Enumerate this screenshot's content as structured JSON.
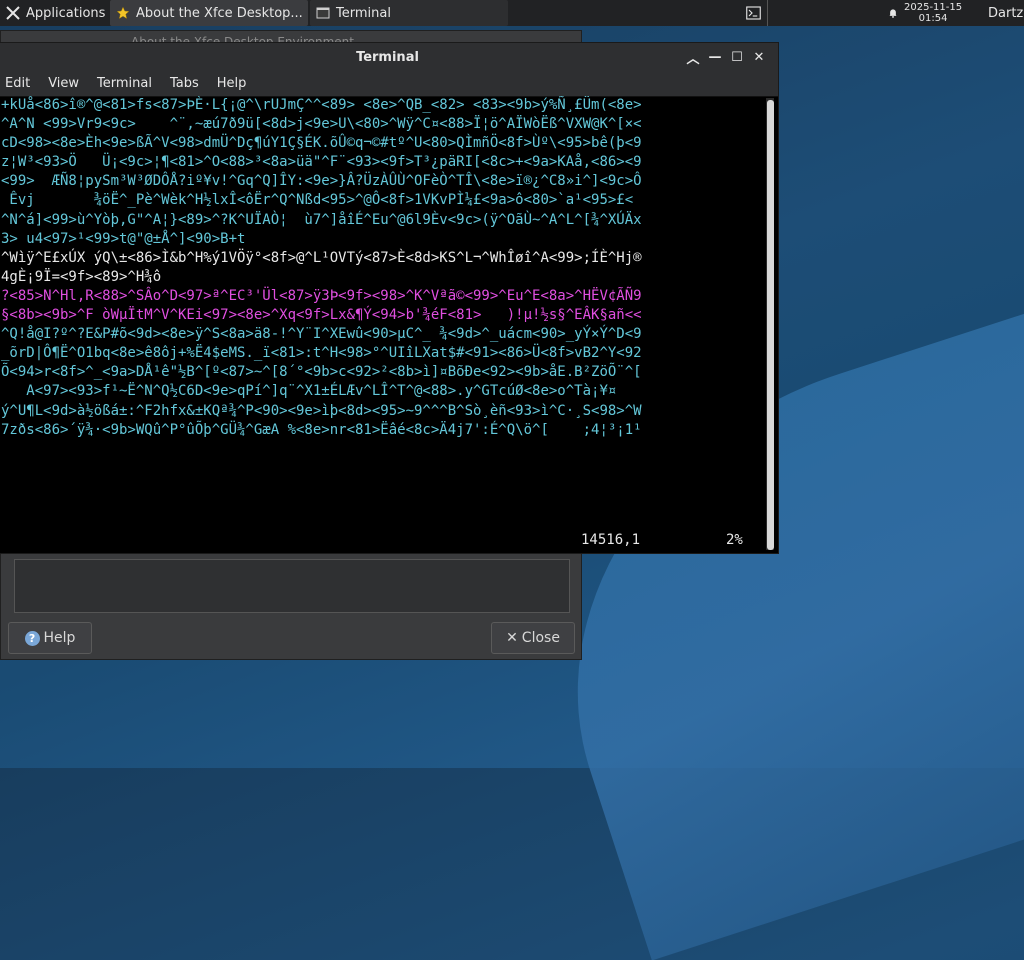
{
  "panel": {
    "apps_label": "Applications",
    "tasks": [
      {
        "label": "About the Xfce Desktop..."
      },
      {
        "label": "Terminal"
      }
    ],
    "clock_date": "2025-11-15",
    "clock_time": "01:54",
    "user": "Dartz"
  },
  "background_window": {
    "title": "About the Xfce Desktop Environment",
    "help_label": "Help",
    "close_label": "Close"
  },
  "terminal": {
    "title": "Terminal",
    "menu": [
      "Edit",
      "View",
      "Terminal",
      "Tabs",
      "Help"
    ],
    "lines": [
      "+kUå<86>î®^@<81>fs<87>ÞÈ·L{¡@^\\rUJmÇ^^<89> <8e>^QB_<82> <83><9b>ý%Ñ¸£Üm(<8e>",
      "^A^N <99>Vr9<9c>    ^¨,~æú7ð9ü[<8d>j<9e>U\\<80>^Wÿ^C¤<88>Ï¦ö^AÏWòËß^VXW@K^[×<",
      "cD<98><8e>Èh<9e>ßÃ^V<98>dmÜ^Dç¶úY1Ç§ÉK.õÛ©q¬©#tº^U<80>QÌmñÖ<8f>Ùº\\<95>bê(þ<9",
      "z¦W³<93>Ö   Ü¡<9c>¦¶<81>^O<88>³<8a>üä\"^F¨<93><9f>T³¿päRI[<8c>+<9a>KAå,<86><9",
      "<99>  ÆÑ8¦pySm³W³ØDÔÅ?iº¥v!^Gq^Q]ÎY:<9e>}Â?ÜzÀÛÙ^OFèÒ^TÎ\\<8e>ï®¿^C8»i^]<9c>Ô",
      " Êvj       ¾öË^_Pè^Wèk^H½lxÎ<ôËr^Q^Nßd<95>^@Ô<8f>1VKvPÌ¼£<9a>ô<80>`a¹<95>£<",
      "^N^á]<99>ù^Yòþ,G\"^A¦}<89>^?K^UÏAÒ¦  ù7^]åîÉ^Eu^@6l9Èv<9c>(ÿ^OãÙ~^A^L^[¾^XÚÄx",
      "3> u4<97>¹<99>t@\"@±Å^]<90>B+t",
      "^Wìÿ^E£xÚX ýQ\\±<86>Ì&b^H%ý1VÖÿ°<8f>@^L¹OVTý<87>È<8d>KS^L¬^WhÎøî^A<99>;ÍÈ^Hj®",
      "4gÈ¡9Ï=<9f><89>^H¾ô",
      "?<85>N^Hl,R<88>^SÂo^D<97>ª^EC³'Ül<87>ÿ3Þ<9f><98>^K^Vªã©<99>^Eu^E<8a>^HËV¢ÃÑ9",
      "§<8b><9b>^F òWµÏtM^V^KEi<97><8e>^Xq<9f>Lx&¶Ý<94>b'¾éF<81>   )!µ!½s§^EÂK§añ<<",
      "^Q!å@I?º^?E&P#õ<9d><8e>ÿ^S<8a>ä8-!^Y¨I^XEwû<90>µC^_ ¾<9d>^_uácm<90>_yÝ×Ý^D<9",
      "_õrD|Ô¶Ë^O1bq<8e>ê8ôj+%Ë4$eMS._ï<81>:t^H<98>°^UIîLXat$#<91><86>Ü<8f>vB2^Y<92",
      "Õ<94>r<8f>^_<9a>DÅ¹ê\"½B^[º<87>~^[8´°<9b>c<92>²<8b>ì]¤BõÐe<92><9b>åE.B²ZöÕ¨^[",
      "   A<97><93>f¹~Ë^N^Q½C6D<9e>qPí^]q¨^X1±ÉLÆv^LÎ^T^@<88>.y^GTcúØ<8e>o^Tà¡¥¤",
      "ý^U¶L<9d>à½ößá±:^F2hfx&±KQª¾^P<90><9e>ìþ<8d><95>~9^^^B^Sò¸èñ<93>ì^C·¸S<98>^W",
      "7zðs<86>´ÿ¾·<9b>WQû^P°ûÕþ^GÜ¾^GæA %<8e>nr<81>Ëâé<8c>Ä4j7':É^Q\\ö^[    ;4¦³¡1¹"
    ],
    "status_position": "14516,1",
    "status_percent": "2%"
  }
}
